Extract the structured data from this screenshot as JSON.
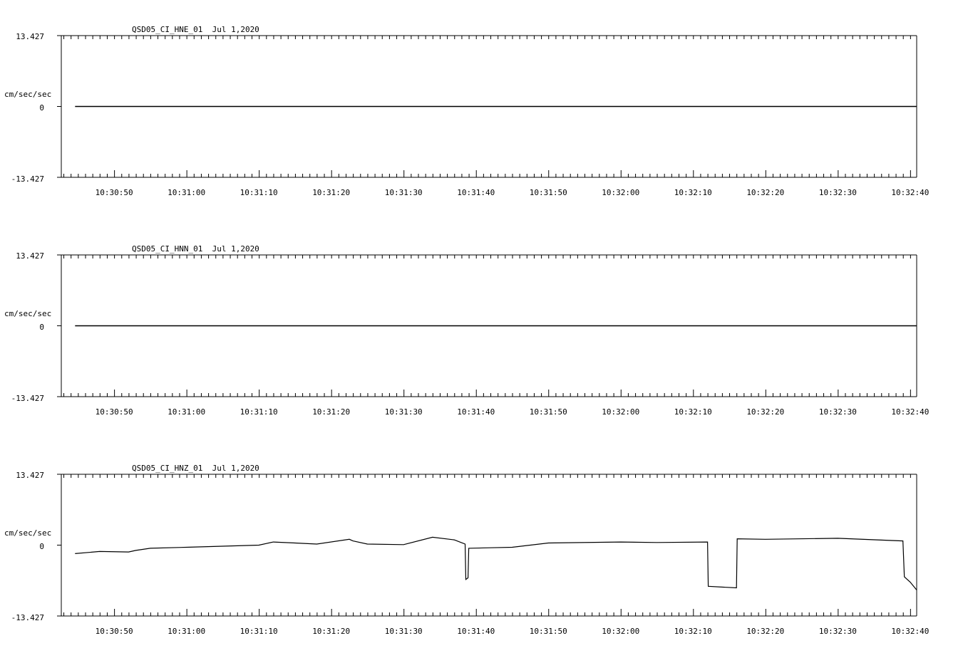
{
  "chart_data": [
    {
      "type": "line",
      "title": "QSD05_CI_HNE_01  Jul 1,2020",
      "ylabel": "cm/sec/sec",
      "ylim": [
        -13.427,
        13.427
      ],
      "y_tick_labels": [
        "13.427",
        "0",
        "-13.427"
      ],
      "x_range_seconds": [
        37842.7,
        37960.9
      ],
      "x_tick_labels": [
        "10:30:50",
        "10:31:00",
        "10:31:10",
        "10:31:20",
        "10:31:30",
        "10:31:40",
        "10:31:50",
        "10:32:00",
        "10:32:10",
        "10:32:20",
        "10:32:30",
        "10:32:40"
      ],
      "series": [
        {
          "x": [
            "10:30:44.6",
            "10:32:40.9"
          ],
          "y": [
            0,
            0
          ]
        }
      ]
    },
    {
      "type": "line",
      "title": "QSD05_CI_HNN_01  Jul 1,2020",
      "ylabel": "cm/sec/sec",
      "ylim": [
        -13.427,
        13.427
      ],
      "y_tick_labels": [
        "13.427",
        "0",
        "-13.427"
      ],
      "x_range_seconds": [
        37842.7,
        37960.9
      ],
      "x_tick_labels": [
        "10:30:50",
        "10:31:00",
        "10:31:10",
        "10:31:20",
        "10:31:30",
        "10:31:40",
        "10:31:50",
        "10:32:00",
        "10:32:10",
        "10:32:20",
        "10:32:30",
        "10:32:40"
      ],
      "series": [
        {
          "x": [
            "10:30:44.6",
            "10:32:40.9"
          ],
          "y": [
            0,
            0
          ]
        }
      ]
    },
    {
      "type": "line",
      "title": "QSD05_CI_HNZ_01  Jul 1,2020",
      "ylabel": "cm/sec/sec",
      "ylim": [
        -13.427,
        13.427
      ],
      "y_tick_labels": [
        "13.427",
        "0",
        "-13.427"
      ],
      "x_range_seconds": [
        37842.7,
        37960.9
      ],
      "x_tick_labels": [
        "10:30:50",
        "10:31:00",
        "10:31:10",
        "10:31:20",
        "10:31:30",
        "10:31:40",
        "10:31:50",
        "10:32:00",
        "10:32:10",
        "10:32:20",
        "10:32:30",
        "10:32:40"
      ],
      "series": [
        {
          "x": [
            "10:30:44.6",
            "10:30:48.0",
            "10:30:52.0",
            "10:30:53.0",
            "10:30:55.0",
            "10:31:00.0",
            "10:31:05.0",
            "10:31:10.0",
            "10:31:12.0",
            "10:31:15.0",
            "10:31:18.0",
            "10:31:22.5",
            "10:31:23.0",
            "10:31:25.0",
            "10:31:30.0",
            "10:31:34.0",
            "10:31:37.0",
            "10:31:38.5",
            "10:31:38.6",
            "10:31:38.9",
            "10:31:39.0",
            "10:31:42.0",
            "10:31:45.0",
            "10:31:50.0",
            "10:32:00.0",
            "10:32:05.0",
            "10:32:12.0",
            "10:32:12.1",
            "10:32:16.0",
            "10:32:16.1",
            "10:32:20.0",
            "10:32:30.0",
            "10:32:39.0",
            "10:32:39.2",
            "10:32:40.0",
            "10:32:40.9"
          ],
          "y": [
            -1.6,
            -1.2,
            -1.3,
            -1.0,
            -0.6,
            -0.4,
            -0.2,
            0.0,
            0.6,
            0.4,
            0.2,
            1.1,
            0.8,
            0.2,
            0.1,
            1.5,
            1.0,
            0.2,
            -6.5,
            -6.2,
            -0.6,
            -0.5,
            -0.4,
            0.4,
            0.6,
            0.5,
            0.6,
            -7.8,
            -8.1,
            1.2,
            1.1,
            1.3,
            0.8,
            -6.0,
            -7.0,
            -8.5
          ]
        }
      ]
    }
  ]
}
